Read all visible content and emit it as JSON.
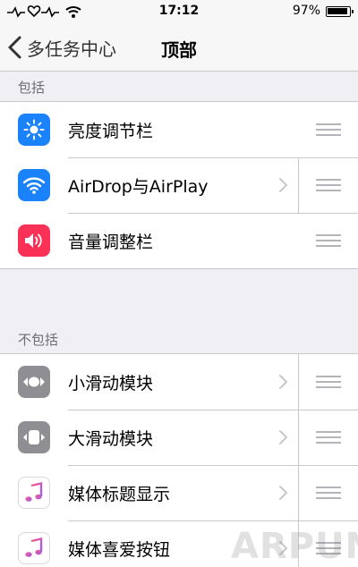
{
  "status_bar": {
    "time": "17:12",
    "battery": "97%"
  },
  "nav": {
    "back_label": "多任务中心",
    "title": "顶部"
  },
  "sections": [
    {
      "header": "包括",
      "items": [
        {
          "label": "亮度调节栏",
          "icon": "brightness-icon",
          "icon_color": "#1a82fb",
          "chevron": false
        },
        {
          "label": "AirDrop与AirPlay",
          "icon": "wifi-icon",
          "icon_color": "#1a82fb",
          "chevron": true
        },
        {
          "label": "音量调整栏",
          "icon": "volume-icon",
          "icon_color": "#fc3158",
          "chevron": false
        }
      ]
    },
    {
      "header": "不包括",
      "items": [
        {
          "label": "小滑动模块",
          "icon": "small-slider-icon",
          "icon_color": "#8e8e93",
          "chevron": true
        },
        {
          "label": "大滑动模块",
          "icon": "large-slider-icon",
          "icon_color": "#8e8e93",
          "chevron": true
        },
        {
          "label": "媒体标题显示",
          "icon": "music-note-icon",
          "icon_color": "#ffffff",
          "chevron": true
        },
        {
          "label": "媒体喜爱按钮",
          "icon": "music-note-icon",
          "icon_color": "#ffffff",
          "chevron": true
        }
      ]
    }
  ],
  "watermark": "ARPUN"
}
